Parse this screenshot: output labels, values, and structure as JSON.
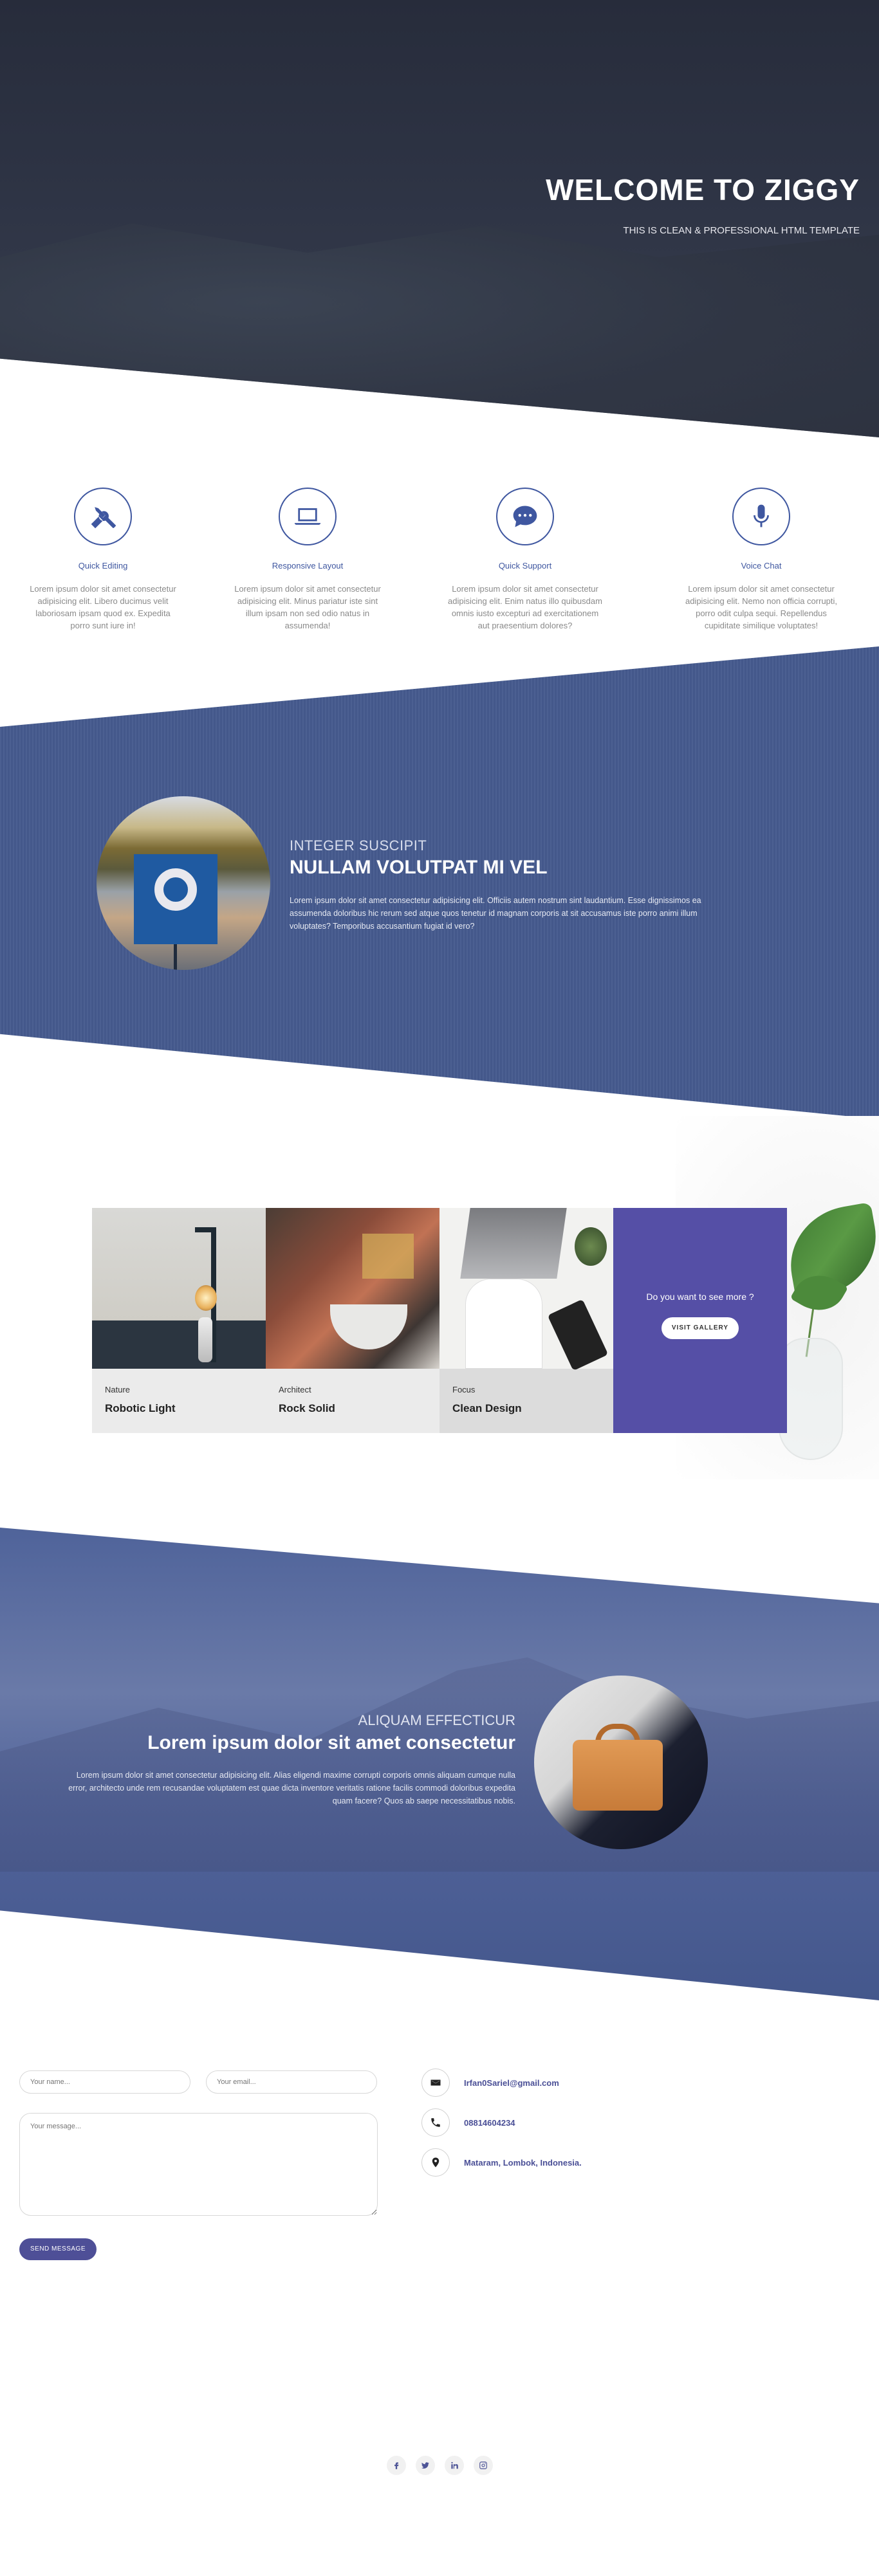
{
  "hero": {
    "title": "WELCOME TO ZIGGY",
    "subtitle": "THIS IS CLEAN & PROFESSIONAL HTML TEMPLATE"
  },
  "features": [
    {
      "icon": "tools-icon",
      "title": "Quick Editing",
      "text": "Lorem ipsum dolor sit amet consectetur adipisicing elit. Libero ducimus velit laboriosam ipsam quod ex. Expedita porro sunt iure in!"
    },
    {
      "icon": "laptop-icon",
      "title": "Responsive Layout",
      "text": "Lorem ipsum dolor sit amet consectetur adipisicing elit. Minus pariatur iste sint illum ipsam non sed odio natus in assumenda!"
    },
    {
      "icon": "chat-icon",
      "title": "Quick Support",
      "text": "Lorem ipsum dolor sit amet consectetur adipisicing elit. Enim natus illo quibusdam omnis iusto excepturi ad exercitationem aut praesentium dolores?"
    },
    {
      "icon": "microphone-icon",
      "title": "Voice Chat",
      "text": "Lorem ipsum dolor sit amet consectetur adipisicing elit. Nemo non officia corrupti, porro odit culpa sequi. Repellendus cupiditate similique voluptates!"
    }
  ],
  "section1": {
    "eyebrow": "INTEGER SUSCIPIT",
    "title": "NULLAM VOLUTPAT MI VEL",
    "text": "Lorem ipsum dolor sit amet consectetur adipisicing elit. Officiis autem nostrum sint laudantium. Esse dignissimos ea assumenda doloribus hic rerum sed atque quos tenetur id magnam corporis at sit accusamus iste porro animi illum voluptates? Temporibus accusantium fugiat id vero?"
  },
  "gallery": {
    "cards": [
      {
        "category": "Nature",
        "name": "Robotic Light"
      },
      {
        "category": "Architect",
        "name": "Rock Solid"
      },
      {
        "category": "Focus",
        "name": "Clean Design"
      }
    ],
    "more_text": "Do you want to see more ?",
    "visit_label": "VISIT GALLERY"
  },
  "section2": {
    "eyebrow": "ALIQUAM EFFECTICUR",
    "title": "Lorem ipsum dolor sit amet consectetur",
    "text": "Lorem ipsum dolor sit amet consectetur adipisicing elit. Alias eligendi maxime corrupti corporis omnis aliquam cumque nulla error, architecto unde rem recusandae voluptatem est quae dicta inventore veritatis ratione facilis commodi doloribus expedita quam facere? Quos ab saepe necessitatibus nobis."
  },
  "contact": {
    "name_placeholder": "Your name...",
    "email_placeholder": "Your email...",
    "message_placeholder": "Your message...",
    "send_label": "SEND MESSAGE",
    "email": "Irfan0Sariel@gmail.com",
    "phone": "08814604234",
    "address": "Mataram, Lombok, Indonesia."
  },
  "footer": {
    "social": [
      "facebook-icon",
      "twitter-icon",
      "linkedin-icon",
      "instagram-icon"
    ]
  },
  "colors": {
    "accent": "#465b8f",
    "gallery_more": "#554fa6",
    "send_button": "#4e4f97",
    "hero_bg": "#2e3445"
  }
}
